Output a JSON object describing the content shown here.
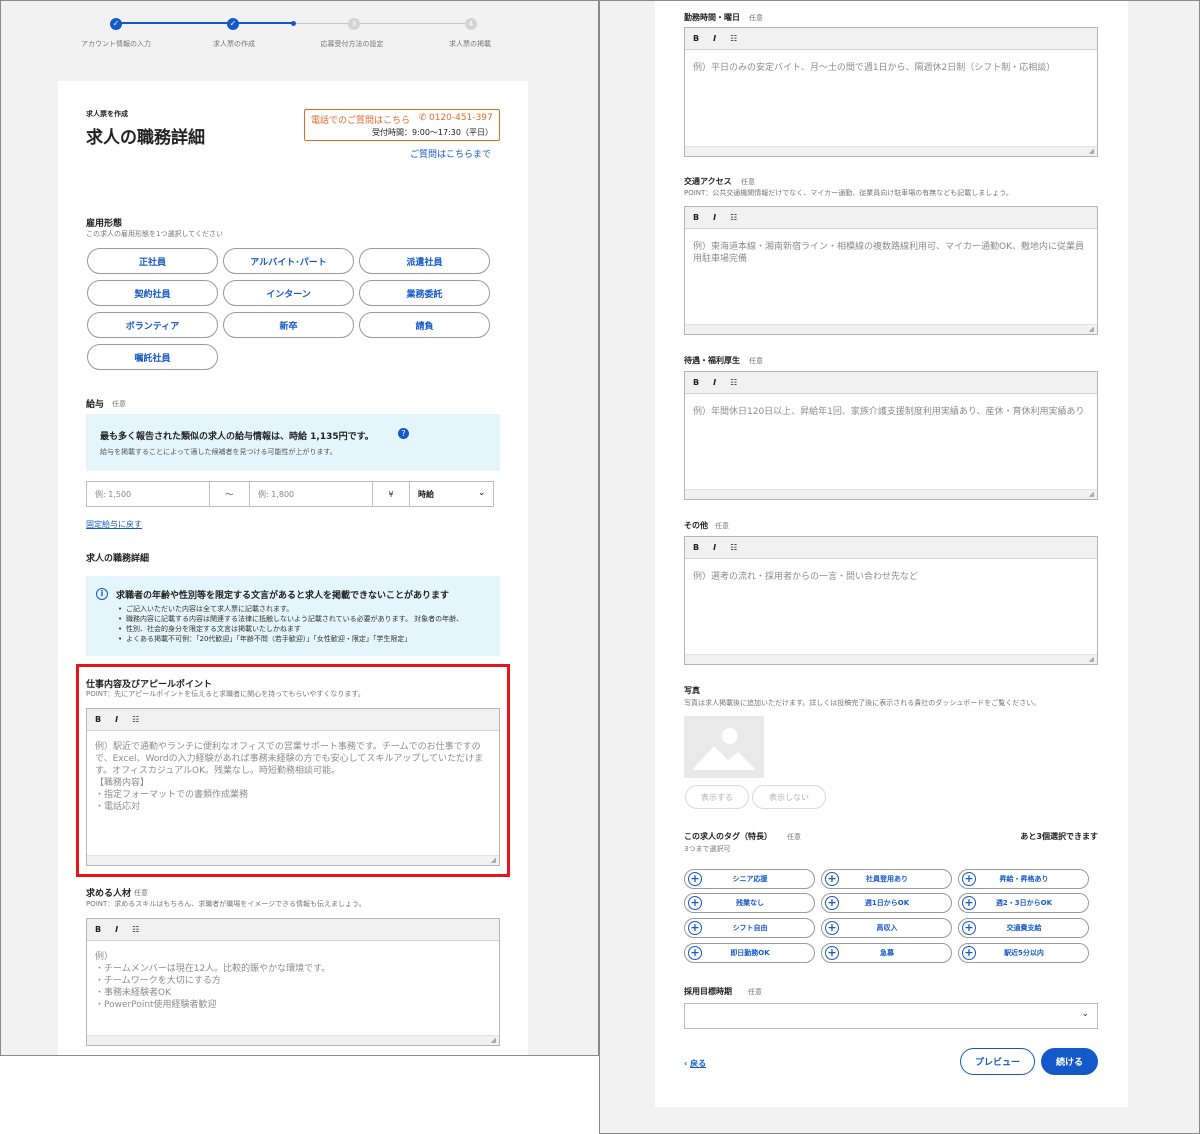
{
  "stepper": {
    "steps": [
      "アカウント情報の入力",
      "求人票の作成",
      "応募受付方法の設定",
      "求人票の掲載"
    ],
    "numbers": [
      "3",
      "4"
    ]
  },
  "header": {
    "eyebrow": "求人票を作成",
    "title": "求人の職務詳細",
    "phone_prefix": "電話でのご質問はこちら",
    "phone_number": "0120-451-397",
    "phone_hours": "受付時間：9:00〜17:30（平日）",
    "question_link": "ご質問はこちらまで"
  },
  "employment": {
    "label": "雇用形態",
    "hint": "この求人の雇用形態を1つ選択してください",
    "options": [
      "正社員",
      "アルバイト･パート",
      "派遣社員",
      "契約社員",
      "インターン",
      "業務委託",
      "ボランティア",
      "新卒",
      "請負",
      "嘱託社員"
    ]
  },
  "salary": {
    "label": "給与",
    "optional": "任意",
    "info_title": "最も多く報告された類似の求人の給与情報は、時給 1,135円です。",
    "info_sub": "給与を掲載することによって適した候補者を見つける可能性が上がります。",
    "min_placeholder": "例: 1,500",
    "sep": "〜",
    "max_placeholder": "例: 1,800",
    "unit": "¥",
    "period": "時給",
    "fixed_link": "固定給与に戻す"
  },
  "details": {
    "section_title": "求人の職務詳細",
    "warn_title": "求職者の年齢や性別等を限定する文言があると求人を掲載できないことがあります",
    "warn_items": [
      "ご記入いただいた内容は全て求人票に記載されます。",
      "職務内容に記載する内容は関連する法律に抵触しないよう記載されている必要があります。 対象者の年齢、",
      "性別、社会的身分を限定する文言は掲載いたしかねます",
      "よくある掲載不可例：「20代歓迎」「年齢不問（若手歓迎）」「女性歓迎・限定」「学生限定」"
    ]
  },
  "toolbar": {
    "bold": "B",
    "italic": "I",
    "list": "☷"
  },
  "appeal": {
    "label": "仕事内容及びアピールポイント",
    "hint": "POINT：先にアピールポイントを伝えると求職者に関心を持ってもらいやすくなります。",
    "placeholder": "例）駅近で通勤やランチに便利なオフィスでの営業サポート事務です。チームでのお仕事ですので、Excel、Wordの入力経験があれば事務未経験の方でも安心してスキルアップしていただけます。オフィスカジュアルOK。残業なし。時短勤務相談可能。\n【職務内容】\n・指定フォーマットでの書類作成業務\n・電話応対"
  },
  "requirements": {
    "label": "求める人材",
    "optional": "任意",
    "hint": "POINT：求めるスキルはもちろん、求職者が職場をイメージできる情報も伝えましょう。",
    "placeholder": "例）\n・チームメンバーは現在12人。比較的賑やかな環境です。\n・チームワークを大切にする方\n・事務未経験者OK\n・PowerPoint使用経験者歓迎"
  },
  "hours": {
    "label": "勤務時間・曜日",
    "optional": "任意",
    "placeholder": "例）平日のみの安定バイト、月〜土の間で週1日から、隔週休2日制（シフト制・応相談）"
  },
  "access": {
    "label": "交通アクセス",
    "optional": "任意",
    "hint": "POINT：公共交通機関情報だけでなく、マイカー通勤、従業員向け駐車場の有無なども記載しましょう。",
    "placeholder": "例）東海道本線・湘南新宿ライン・相模線の複数路線利用可、マイカー通勤OK、敷地内に従業員用駐車場完備"
  },
  "benefits": {
    "label": "待遇・福利厚生",
    "optional": "任意",
    "placeholder": "例）年間休日120日以上、昇給年1回、家族介護支援制度利用実績あり、産休・育休利用実績あり"
  },
  "other": {
    "label": "その他",
    "optional": "任意",
    "placeholder": "例）選考の流れ・採用者からの一言・問い合わせ先など"
  },
  "photo": {
    "label": "写真",
    "hint": "写真は求人掲載後に追加いただけます。詳しくは投稿完了後に表示される貴社のダッシュボードをご覧ください。",
    "show": "表示する",
    "hide": "表示しない"
  },
  "tags": {
    "label": "この求人のタグ（特長）",
    "optional": "任意",
    "limit": "3つまで選択可",
    "remaining": "あと3個選択できます",
    "items": [
      "シニア応援",
      "社員登用あり",
      "昇給・昇格あり",
      "残業なし",
      "週1日からOK",
      "週2・3日からOK",
      "シフト自由",
      "高収入",
      "交通費支給",
      "即日勤務OK",
      "急募",
      "駅近5分以内"
    ]
  },
  "target": {
    "label": "採用目標時期",
    "optional": "任意",
    "value": ""
  },
  "footer": {
    "back": "戻る",
    "preview": "プレビュー",
    "next": "続ける"
  },
  "colors": {
    "accent": "#1559c9",
    "highlight": "#e5161b",
    "info_bg": "#e4f6fb",
    "phone": "#e06a2a"
  }
}
